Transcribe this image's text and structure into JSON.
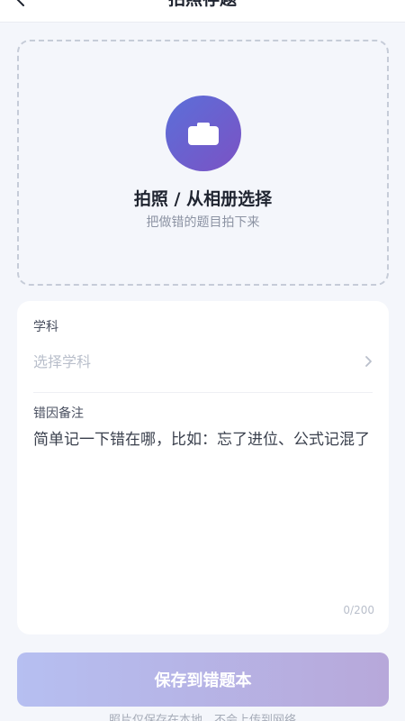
{
  "header": {
    "title": "拍照存题",
    "back_icon": "chevron-left-icon"
  },
  "upload": {
    "icon": "camera-icon",
    "title": "拍照 / 从相册选择",
    "subtitle": "把做错的题目拍下来"
  },
  "form": {
    "subject_label": "学科",
    "subject_placeholder": "选择学科",
    "note_label": "错因备注",
    "note_placeholder": "简单记一下错在哪，比如：忘了进位、公式记混了",
    "char_count": "0/200"
  },
  "actions": {
    "save_label": "保存到错题本"
  },
  "footer": {
    "hint": "照片仅保存在本地，不会上传到网络"
  },
  "colors": {
    "accent_start": "#5b6fd9",
    "accent_end": "#7b52c4",
    "button_start": "#b6bff1",
    "button_end": "#b7a8da",
    "background": "#f4f6fb"
  }
}
